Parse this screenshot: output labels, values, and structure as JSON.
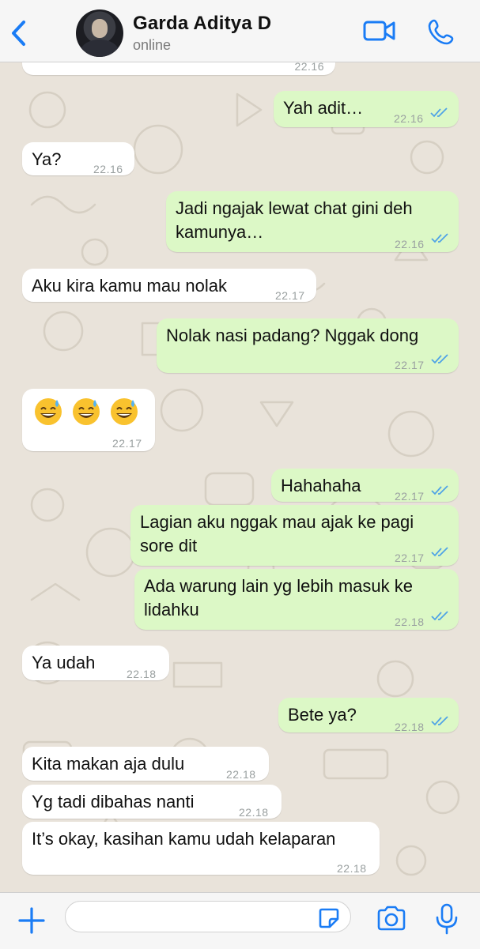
{
  "header": {
    "name": "Garda Aditya D",
    "status": "online",
    "back_icon": "chevron-left-icon",
    "video_icon": "video-camera-icon",
    "call_icon": "phone-icon"
  },
  "colors": {
    "accent": "#1a7cf5",
    "outgoing_bubble": "#dcf8c6",
    "incoming_bubble": "#ffffff",
    "read_ticks": "#4fa3e6"
  },
  "messages": [
    {
      "dir": "in",
      "text": "",
      "time": "22.16"
    },
    {
      "dir": "out",
      "text": "Yah adit…",
      "time": "22.16",
      "read": true
    },
    {
      "dir": "in",
      "text": "Ya?",
      "time": "22.16"
    },
    {
      "dir": "out",
      "lines": [
        "Jadi ngajak lewat chat gini deh",
        "kamunya…"
      ],
      "time": "22.16",
      "read": true
    },
    {
      "dir": "in",
      "text": "Aku kira kamu mau nolak",
      "time": "22.17"
    },
    {
      "dir": "out",
      "text": "Nolak nasi padang? Nggak dong",
      "time": "22.17",
      "read": true
    },
    {
      "dir": "in",
      "emoji": [
        "grinning-face-with-sweat",
        "grinning-face-with-sweat",
        "grinning-face-with-sweat"
      ],
      "time": "22.17"
    },
    {
      "dir": "out",
      "text": "Hahahaha",
      "time": "22.17",
      "read": true
    },
    {
      "dir": "out",
      "lines": [
        "Lagian aku nggak mau ajak ke pagi",
        "sore dit"
      ],
      "time": "22.17",
      "read": true
    },
    {
      "dir": "out",
      "lines": [
        "Ada warung lain yg lebih masuk ke",
        "lidahku"
      ],
      "time": "22.18",
      "read": true
    },
    {
      "dir": "in",
      "text": "Ya udah",
      "time": "22.18"
    },
    {
      "dir": "out",
      "text": "Bete ya?",
      "time": "22.18",
      "read": true
    },
    {
      "dir": "in",
      "text": "Kita makan aja dulu",
      "time": "22.18"
    },
    {
      "dir": "in",
      "text": "Yg tadi dibahas nanti",
      "time": "22.18"
    },
    {
      "dir": "in",
      "text": "It’s okay, kasihan kamu udah kelaparan",
      "time": "22.18"
    }
  ],
  "footer": {
    "plus_icon": "plus-icon",
    "input_value": "",
    "input_placeholder": "",
    "sticker_icon": "sticker-icon",
    "camera_icon": "camera-icon",
    "mic_icon": "microphone-icon"
  }
}
